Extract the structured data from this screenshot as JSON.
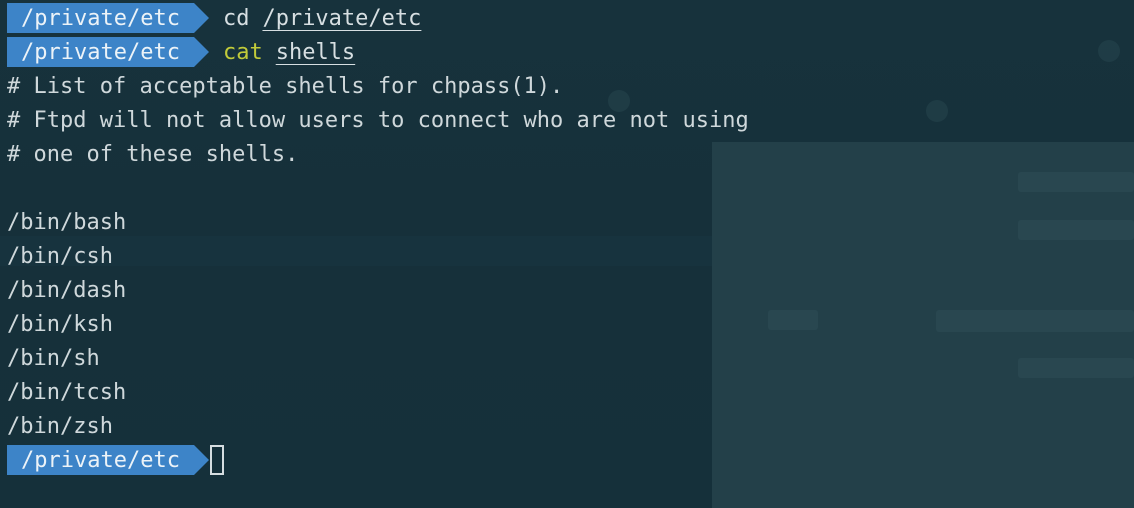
{
  "prompt": {
    "cwd": "/private/etc",
    "accent_color": "#3d84c8",
    "separator_icon": "powerline-arrow"
  },
  "commands": [
    {
      "cmd": "cd",
      "arg": "/private/etc"
    },
    {
      "cmd": "cat",
      "arg": "shells"
    }
  ],
  "output": {
    "comments": [
      "# List of acceptable shells for chpass(1).",
      "# Ftpd will not allow users to connect who are not using",
      "# one of these shells."
    ],
    "shells": [
      "/bin/bash",
      "/bin/csh",
      "/bin/dash",
      "/bin/ksh",
      "/bin/sh",
      "/bin/tcsh",
      "/bin/zsh"
    ]
  },
  "colors": {
    "background": "#15303a",
    "text": "#d5dde0",
    "command_highlight": "#c2cb3a"
  }
}
